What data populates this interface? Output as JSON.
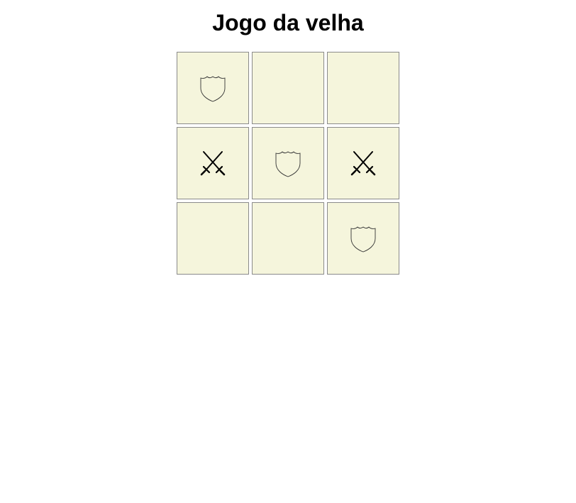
{
  "title": "Jogo da velha",
  "board": {
    "cells": [
      "shield",
      "",
      "",
      "swords",
      "shield",
      "swords",
      "",
      "",
      "shield"
    ]
  },
  "colors": {
    "cell_background": "#f5f5dc",
    "cell_border": "#8a8a8a"
  },
  "icons": {
    "shield": "shield-icon",
    "swords": "crossed-swords-icon"
  }
}
